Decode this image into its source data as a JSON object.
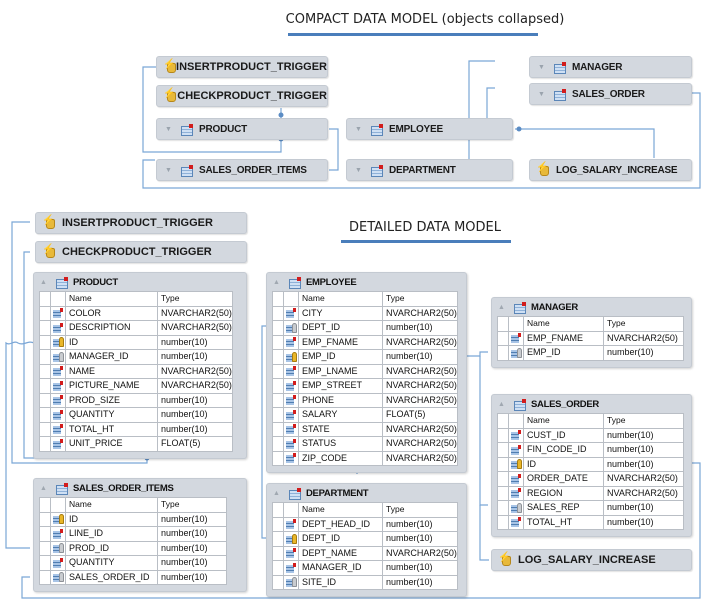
{
  "compact": {
    "title": "COMPACT DATA MODEL (objects collapsed)",
    "objects": {
      "insertproduct_trigger": {
        "label": "INSERTPRODUCT_TRIGGER",
        "kind": "trigger",
        "icon": "trigger-icon"
      },
      "checkproduct_trigger": {
        "label": "CHECKPRODUCT_TRIGGER",
        "kind": "trigger",
        "icon": "trigger-icon"
      },
      "product": {
        "label": "PRODUCT",
        "kind": "table",
        "icon": "table-icon"
      },
      "sales_order_items": {
        "label": "SALES_ORDER_ITEMS",
        "kind": "table",
        "icon": "table-icon"
      },
      "employee": {
        "label": "EMPLOYEE",
        "kind": "table",
        "icon": "table-icon"
      },
      "department": {
        "label": "DEPARTMENT",
        "kind": "table",
        "icon": "table-icon"
      },
      "manager": {
        "label": "MANAGER",
        "kind": "table",
        "icon": "table-icon"
      },
      "sales_order": {
        "label": "SALES_ORDER",
        "kind": "table",
        "icon": "table-icon"
      },
      "log_salary_increase": {
        "label": "LOG_SALARY_INCREASE",
        "kind": "trigger",
        "icon": "trigger-icon"
      }
    }
  },
  "detailed": {
    "title": "DETAILED DATA MODEL",
    "column_headers": {
      "name": "Name",
      "type": "Type"
    },
    "triggers": {
      "insertproduct_trigger": "INSERTPRODUCT_TRIGGER",
      "checkproduct_trigger": "CHECKPRODUCT_TRIGGER",
      "log_salary_increase": "LOG_SALARY_INCREASE"
    },
    "tables": {
      "product": {
        "name": "PRODUCT",
        "columns": [
          {
            "name": "COLOR",
            "type": "NVARCHAR2(50)",
            "key": "none"
          },
          {
            "name": "DESCRIPTION",
            "type": "NVARCHAR2(50)",
            "key": "none"
          },
          {
            "name": "ID",
            "type": "number(10)",
            "key": "primary"
          },
          {
            "name": "MANAGER_ID",
            "type": "number(10)",
            "key": "foreign"
          },
          {
            "name": "NAME",
            "type": "NVARCHAR2(50)",
            "key": "none"
          },
          {
            "name": "PICTURE_NAME",
            "type": "NVARCHAR2(50)",
            "key": "none"
          },
          {
            "name": "PROD_SIZE",
            "type": "number(10)",
            "key": "none"
          },
          {
            "name": "QUANTITY",
            "type": "number(10)",
            "key": "none"
          },
          {
            "name": "TOTAL_HT",
            "type": "number(10)",
            "key": "none"
          },
          {
            "name": "UNIT_PRICE",
            "type": "FLOAT(5)",
            "key": "none"
          }
        ]
      },
      "sales_order_items": {
        "name": "SALES_ORDER_ITEMS",
        "columns": [
          {
            "name": "ID",
            "type": "number(10)",
            "key": "primary"
          },
          {
            "name": "LINE_ID",
            "type": "number(10)",
            "key": "none"
          },
          {
            "name": "PROD_ID",
            "type": "number(10)",
            "key": "foreign"
          },
          {
            "name": "QUANTITY",
            "type": "number(10)",
            "key": "none"
          },
          {
            "name": "SALES_ORDER_ID",
            "type": "number(10)",
            "key": "foreign"
          }
        ]
      },
      "employee": {
        "name": "EMPLOYEE",
        "columns": [
          {
            "name": "CITY",
            "type": "NVARCHAR2(50)",
            "key": "none"
          },
          {
            "name": "DEPT_ID",
            "type": "number(10)",
            "key": "foreign"
          },
          {
            "name": "EMP_FNAME",
            "type": "NVARCHAR2(50)",
            "key": "none"
          },
          {
            "name": "EMP_ID",
            "type": "number(10)",
            "key": "primary"
          },
          {
            "name": "EMP_LNAME",
            "type": "NVARCHAR2(50)",
            "key": "none"
          },
          {
            "name": "EMP_STREET",
            "type": "NVARCHAR2(50)",
            "key": "none"
          },
          {
            "name": "PHONE",
            "type": "NVARCHAR2(50)",
            "key": "none"
          },
          {
            "name": "SALARY",
            "type": "FLOAT(5)",
            "key": "none"
          },
          {
            "name": "STATE",
            "type": "NVARCHAR2(50)",
            "key": "none"
          },
          {
            "name": "STATUS",
            "type": "NVARCHAR2(50)",
            "key": "none"
          },
          {
            "name": "ZIP_CODE",
            "type": "NVARCHAR2(50)",
            "key": "none"
          }
        ]
      },
      "department": {
        "name": "DEPARTMENT",
        "columns": [
          {
            "name": "DEPT_HEAD_ID",
            "type": "number(10)",
            "key": "none"
          },
          {
            "name": "DEPT_ID",
            "type": "number(10)",
            "key": "primary"
          },
          {
            "name": "DEPT_NAME",
            "type": "NVARCHAR2(50)",
            "key": "none"
          },
          {
            "name": "MANAGER_ID",
            "type": "number(10)",
            "key": "none"
          },
          {
            "name": "SITE_ID",
            "type": "number(10)",
            "key": "foreign"
          }
        ]
      },
      "manager": {
        "name": "MANAGER",
        "columns": [
          {
            "name": "EMP_FNAME",
            "type": "NVARCHAR2(50)",
            "key": "none"
          },
          {
            "name": "EMP_ID",
            "type": "number(10)",
            "key": "foreign"
          }
        ]
      },
      "sales_order": {
        "name": "SALES_ORDER",
        "columns": [
          {
            "name": "CUST_ID",
            "type": "number(10)",
            "key": "none"
          },
          {
            "name": "FIN_CODE_ID",
            "type": "number(10)",
            "key": "none"
          },
          {
            "name": "ID",
            "type": "number(10)",
            "key": "primary"
          },
          {
            "name": "ORDER_DATE",
            "type": "NVARCHAR2(50)",
            "key": "none"
          },
          {
            "name": "REGION",
            "type": "NVARCHAR2(50)",
            "key": "none"
          },
          {
            "name": "SALES_REP",
            "type": "number(10)",
            "key": "foreign"
          },
          {
            "name": "TOTAL_HT",
            "type": "number(10)",
            "key": "none"
          }
        ]
      }
    }
  },
  "colors": {
    "accent_underline": "#4a7ebb",
    "box_fill": "#d3d8df",
    "connector": "#6f9fd1",
    "table_marker": "#d21c1c",
    "primary_key": "#e9b628"
  }
}
